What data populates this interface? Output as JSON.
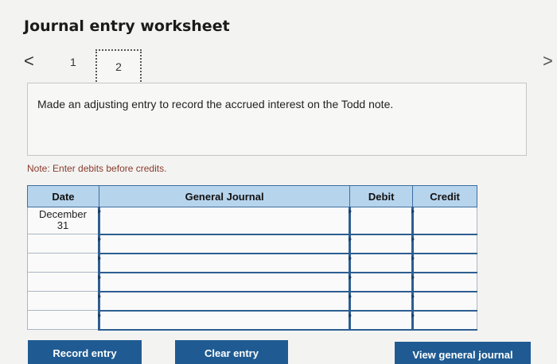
{
  "header": {
    "title": "Journal entry worksheet"
  },
  "pager": {
    "prev_icon": "chevron-left-icon",
    "prev_glyph": "<",
    "next_icon": "chevron-right-icon",
    "next_glyph": ">",
    "pages": [
      "1",
      "2"
    ],
    "current_page": "2"
  },
  "instruction": {
    "text": "Made an adjusting entry to record the accrued interest on the Todd note."
  },
  "note": {
    "text": "Note: Enter debits before credits."
  },
  "journal": {
    "headers": {
      "date": "Date",
      "general_journal": "General Journal",
      "debit": "Debit",
      "credit": "Credit"
    },
    "rows": [
      {
        "date": "December\n31",
        "account": "",
        "debit": "",
        "credit": ""
      },
      {
        "date": "",
        "account": "",
        "debit": "",
        "credit": ""
      },
      {
        "date": "",
        "account": "",
        "debit": "",
        "credit": ""
      },
      {
        "date": "",
        "account": "",
        "debit": "",
        "credit": ""
      },
      {
        "date": "",
        "account": "",
        "debit": "",
        "credit": ""
      },
      {
        "date": "",
        "account": "",
        "debit": "",
        "credit": ""
      }
    ]
  },
  "buttons": {
    "record": "Record entry",
    "clear": "Clear entry",
    "view": "View general journal"
  },
  "colors": {
    "header_bg": "#b7d4ed",
    "button_bg": "#1f5b92",
    "note_text": "#8a3b2a"
  }
}
